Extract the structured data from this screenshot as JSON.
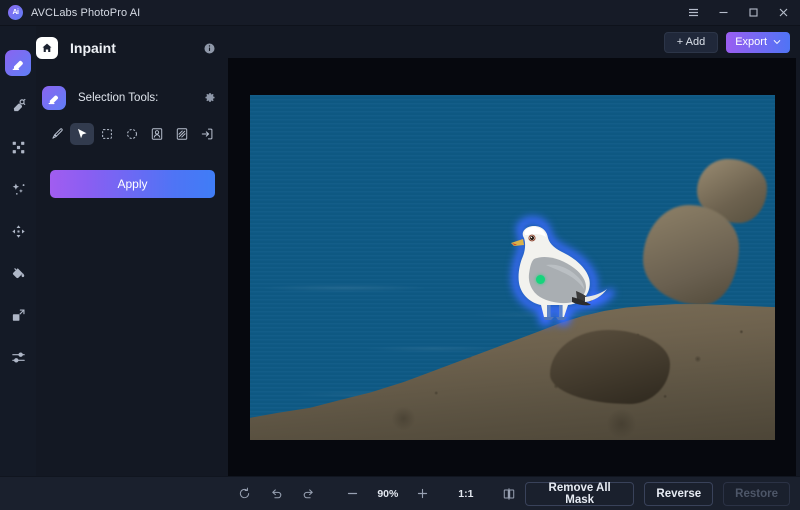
{
  "titlebar": {
    "app_name": "AVCLabs PhotoPro AI",
    "logo_text": "Ai",
    "controls": [
      {
        "name": "menu-button",
        "label": "☰"
      },
      {
        "name": "minimize-button",
        "label": "–"
      },
      {
        "name": "maximize-button",
        "label": "□"
      },
      {
        "name": "close-button",
        "label": "✕"
      }
    ]
  },
  "rail": {
    "items": [
      {
        "icon": "inpaint-icon",
        "label": "Inpaint",
        "active": true
      },
      {
        "icon": "object-removal-icon",
        "label": "Object Removal",
        "active": false
      },
      {
        "icon": "upscale-grid-icon",
        "label": "Upscale",
        "active": false
      },
      {
        "icon": "magic-wand-icon",
        "label": "AI Enhance",
        "active": false
      },
      {
        "icon": "expand-arrows-icon",
        "label": "Expand",
        "active": false
      },
      {
        "icon": "paint-bucket-icon",
        "label": "Colorize",
        "active": false
      },
      {
        "icon": "crop-resize-icon",
        "label": "Crop & Resize",
        "active": false
      },
      {
        "icon": "sliders-icon",
        "label": "Adjustments",
        "active": false
      }
    ]
  },
  "panel": {
    "home_icon": "home-icon",
    "title": "Inpaint",
    "info_icon": "info-icon",
    "section_icon": "inpaint-icon",
    "section_label": "Selection Tools:",
    "settings_icon": "gear-icon",
    "tools": [
      {
        "icon": "brush-tool-icon",
        "label": "Brush",
        "selected": false
      },
      {
        "icon": "cursor-select-tool-icon",
        "label": "Select",
        "selected": true
      },
      {
        "icon": "rectangle-select-tool-icon",
        "label": "Rectangle Select",
        "selected": false
      },
      {
        "icon": "ellipse-select-tool-icon",
        "label": "Ellipse Select",
        "selected": false
      },
      {
        "icon": "portrait-select-tool-icon",
        "label": "Subject Select",
        "selected": false
      },
      {
        "icon": "auto-select-tool-icon",
        "label": "Auto Select",
        "selected": false
      },
      {
        "icon": "import-mask-tool-icon",
        "label": "Import Mask",
        "selected": false
      }
    ],
    "apply_label": "Apply"
  },
  "main": {
    "add_label": "+ Add",
    "export_label": "Export",
    "export_caret": "∨"
  },
  "bottom": {
    "reset_icon": "reset-icon",
    "undo_icon": "undo-icon",
    "redo_icon": "redo-icon",
    "zoom_out_icon": "minus-icon",
    "zoom_value": "90%",
    "zoom_in_icon": "plus-icon",
    "fit_ratio": "1:1",
    "compare_icon": "compare-split-icon",
    "remove_all_mask_label": "Remove All Mask",
    "reverse_label": "Reverse",
    "restore_label": "Restore",
    "restore_disabled": true
  },
  "colors": {
    "accent_purple": "#9a5ef1",
    "accent_blue": "#4f74f5",
    "window_bg": "#131823",
    "canvas_bg": "#06080e",
    "mask_outline": "#3b6bff",
    "marker_green": "#16d47c"
  },
  "photo": {
    "description": "Seagull standing on a rocky ledge above blue ocean water",
    "mask_marker": "green-selection-dot"
  }
}
